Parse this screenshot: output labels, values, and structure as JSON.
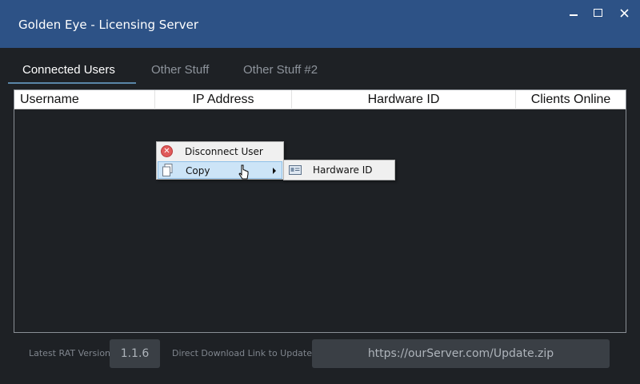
{
  "window": {
    "title": "Golden Eye - Licensing Server"
  },
  "tabs": [
    {
      "label": "Connected Users",
      "active": true
    },
    {
      "label": "Other Stuff",
      "active": false
    },
    {
      "label": "Other Stuff #2",
      "active": false
    }
  ],
  "table": {
    "columns": [
      "Username",
      "IP Address",
      "Hardware ID",
      "Clients Online"
    ],
    "rows": []
  },
  "context_menu": {
    "items": [
      {
        "label": "Disconnect User",
        "icon": "disconnect-icon"
      },
      {
        "label": "Copy",
        "icon": "copy-icon",
        "has_submenu": true,
        "highlighted": true
      }
    ],
    "submenu": {
      "items": [
        {
          "label": "Hardware ID",
          "icon": "id-card-icon"
        }
      ]
    }
  },
  "footer": {
    "version_label": "Latest RAT Version:",
    "version_value": "1.1.6",
    "link_label": "Direct Download Link to Update:",
    "link_value": "https://ourServer.com/Update.zip"
  },
  "colors": {
    "background": "#1e2125",
    "titlebar": "#2d5286",
    "tab_underline": "#5a86a8",
    "menu_highlight": "#cce4f7",
    "field_bg": "#3a3f45"
  }
}
